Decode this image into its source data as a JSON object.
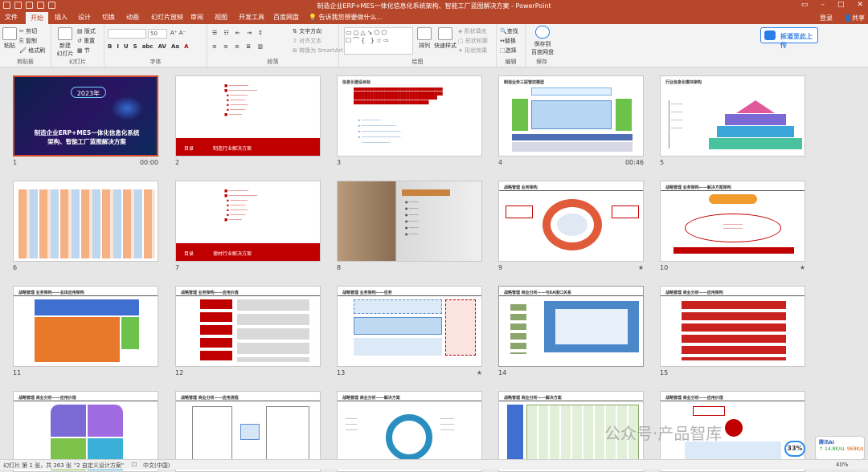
{
  "window": {
    "title": "制造企业ERP+MES一体化信息化系统架构、智能工厂蓝图解决方案 - PowerPoint",
    "login": "登录",
    "share": "共享"
  },
  "tabs": [
    "文件",
    "开始",
    "插入",
    "设计",
    "切换",
    "动画",
    "幻灯片放映",
    "审阅",
    "视图",
    "开发工具",
    "百度网盘"
  ],
  "active_tab": "开始",
  "tellme": "告诉我您想要做什么...",
  "ribbon": {
    "clipboard": {
      "label": "剪贴板",
      "paste": "粘贴",
      "cut": "剪切",
      "copy": "复制",
      "painter": "格式刷"
    },
    "slides": {
      "label": "幻灯片",
      "new": "新建",
      "new2": "幻灯片",
      "layout": "版式",
      "reset": "重置",
      "section": "节"
    },
    "font": {
      "label": "字体",
      "size": "50",
      "font_name": "",
      "buttons": [
        "B",
        "I",
        "U",
        "S",
        "abc",
        "AV",
        "Aa",
        "A"
      ]
    },
    "paragraph": {
      "label": "段落",
      "text_dir": "文字方向",
      "align_text": "对齐文本",
      "smartart": "转换为 SmartArt"
    },
    "drawing": {
      "label": "绘图",
      "arrange": "排列",
      "quick_styles": "快速样式",
      "fill": "形状填充",
      "outline": "形状轮廓",
      "effects": "形状效果"
    },
    "editing": {
      "label": "编辑",
      "find": "查找",
      "replace": "替换",
      "select": "选择"
    },
    "save": {
      "label": "保存",
      "btn1": "保存到",
      "btn2": "百度网盘"
    },
    "upload": "拆道至此上传"
  },
  "slides": [
    {
      "num": "1",
      "time": "00:00",
      "year": "2023年",
      "title1": "制造企业ERP+MES一体化信息化系统",
      "title2": "架构、智能工厂蓝图解决方案"
    },
    {
      "num": "2",
      "left": "目录",
      "right": "制造行业解决方案"
    },
    {
      "num": "3",
      "head": "信息化建设目标"
    },
    {
      "num": "4",
      "time": "00:46",
      "head": "制造业务三层管控模型"
    },
    {
      "num": "5",
      "head": "行业信息化模块架构"
    },
    {
      "num": "6"
    },
    {
      "num": "7",
      "left": "目录",
      "right": "德材行业解决方案"
    },
    {
      "num": "8"
    },
    {
      "num": "9",
      "head": "战略管理 业务架构"
    },
    {
      "num": "10",
      "head": "战略管理 业务架构——解决方案架构"
    },
    {
      "num": "11",
      "head": "战略管理 业务架构——总体应用架构"
    },
    {
      "num": "12",
      "head": "战略管理 业务架构——应用价值"
    },
    {
      "num": "13",
      "head": "战略管理 业务架构——任务"
    },
    {
      "num": "14",
      "head": "战略管理 商业分析——与EA接口关系"
    },
    {
      "num": "15",
      "head": "战略管理 商业分析——应用架构"
    },
    {
      "num": "16",
      "head": "战略管理 商业分析——应用价值"
    },
    {
      "num": "17",
      "head": "战略管理 商业分析——应用流程"
    },
    {
      "num": "18",
      "head": "战略管理 商业分析——解决方案"
    },
    {
      "num": "19",
      "head": "战略管理 商业分析——解决方案"
    },
    {
      "num": "20",
      "head": "战略管理 商业分析——应用价值"
    }
  ],
  "status": {
    "slide_info": "幻灯片 第 1 张，共 263 张",
    "theme": "\"2 自定义设计方案\"",
    "lang": "中文(中国)",
    "zoom": "40%"
  },
  "watermark": "公众号·产品智库",
  "assistant": {
    "name": "腾讯AI",
    "up": "14.8K/s",
    "down": "969K/s",
    "percent": "33%"
  }
}
